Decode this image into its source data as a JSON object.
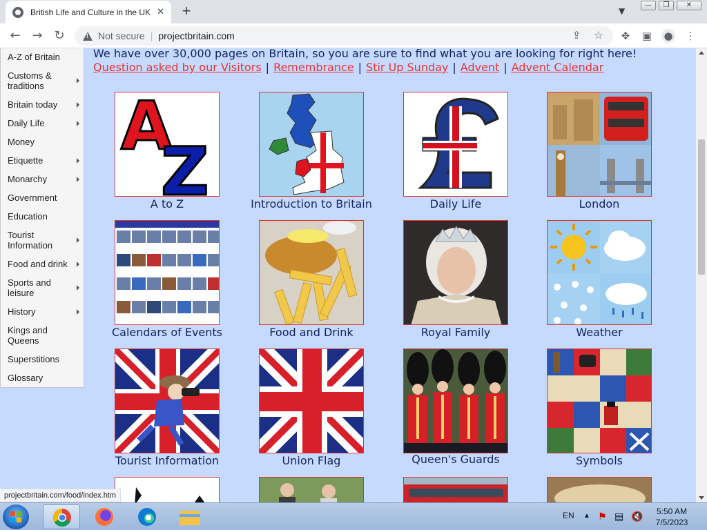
{
  "browser": {
    "tab_title": "British Life and Culture in the UK",
    "url": "projectbritain.com",
    "security_label": "Not secure"
  },
  "sidebar": {
    "items": [
      {
        "label": "A-Z of Britain",
        "has_submenu": false
      },
      {
        "label": "Customs & traditions",
        "has_submenu": true
      },
      {
        "label": "Britain today",
        "has_submenu": true
      },
      {
        "label": "Daily Life",
        "has_submenu": true
      },
      {
        "label": "Money",
        "has_submenu": false
      },
      {
        "label": "Etiquette",
        "has_submenu": true
      },
      {
        "label": "Monarchy",
        "has_submenu": true
      },
      {
        "label": "Government",
        "has_submenu": false
      },
      {
        "label": "Education",
        "has_submenu": false
      },
      {
        "label": "Tourist Information",
        "has_submenu": true
      },
      {
        "label": "Food and drink",
        "has_submenu": true
      },
      {
        "label": "Sports and leisure",
        "has_submenu": true
      },
      {
        "label": "History",
        "has_submenu": true
      },
      {
        "label": "Kings and Queens",
        "has_submenu": false
      },
      {
        "label": "Superstitions",
        "has_submenu": false
      },
      {
        "label": "Glossary",
        "has_submenu": false
      }
    ]
  },
  "content": {
    "intro": "We have over 30,000 pages on Britain, so you are sure to find what you are looking for right here!",
    "links": [
      "Question asked by our Visitors",
      "Remembrance",
      "Stir Up Sunday",
      "Advent",
      "Advent Calendar"
    ],
    "separator": "|",
    "tiles": [
      {
        "caption": "A to Z",
        "icon": "a-to-z-icon"
      },
      {
        "caption": "Introduction to Britain",
        "icon": "uk-map-icon"
      },
      {
        "caption": "Daily Life",
        "icon": "pound-sign-icon"
      },
      {
        "caption": "London",
        "icon": "london-collage-icon"
      },
      {
        "caption": "Calendars of Events",
        "icon": "calendar-grid-icon"
      },
      {
        "caption": "Food and Drink",
        "icon": "fish-and-chips-icon"
      },
      {
        "caption": "Royal Family",
        "icon": "queen-portrait-icon"
      },
      {
        "caption": "Weather",
        "icon": "weather-icon"
      },
      {
        "caption": "Tourist Information",
        "icon": "tourist-cartoon-icon"
      },
      {
        "caption": "Union Flag",
        "icon": "union-flag-icon"
      },
      {
        "caption": "Queen's Guards",
        "icon": "queens-guards-icon"
      },
      {
        "caption": "Symbols",
        "icon": "symbols-pattern-icon"
      }
    ]
  },
  "status_bar": {
    "hover_url": "projectbritain.com/food/index.htm"
  },
  "taskbar": {
    "language": "EN",
    "time": "5:50 AM",
    "date": "7/5/2023"
  }
}
